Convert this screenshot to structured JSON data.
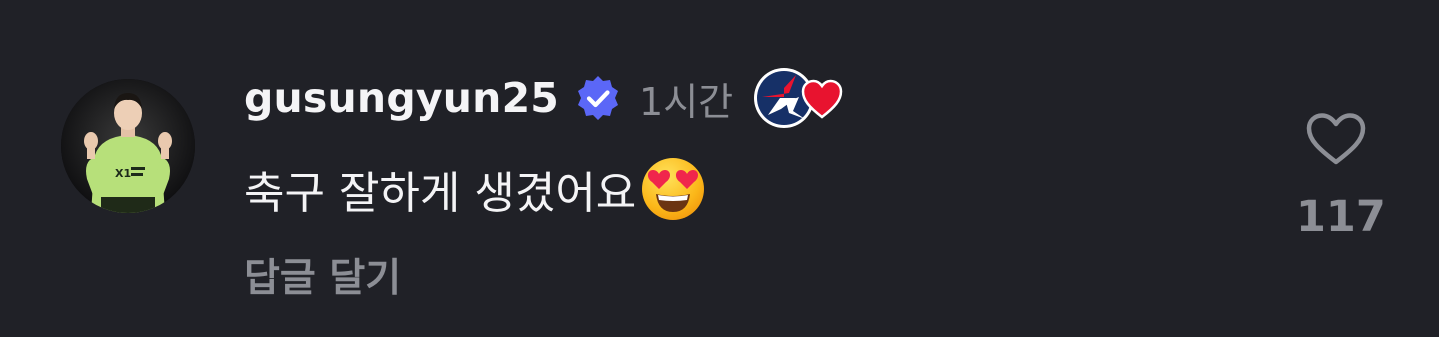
{
  "comment": {
    "username": "gusungyun25",
    "verified_icon": "verified-badge-icon",
    "time_ago": "1시간",
    "badge_icon": "team-logo-heart-badge",
    "text": "축구 잘하게 생겼어요",
    "emoji": "smiling-face-with-heart-eyes",
    "reply_label": "답글 달기",
    "like_icon": "heart-outline-icon",
    "like_count": "117",
    "avatar": "profile-photo-soccer-player"
  },
  "colors": {
    "background": "#202127",
    "primary_text": "#f4f4f6",
    "secondary_text": "#8c8e95",
    "verified": "#5b67f7",
    "heart_red": "#e8132f"
  }
}
